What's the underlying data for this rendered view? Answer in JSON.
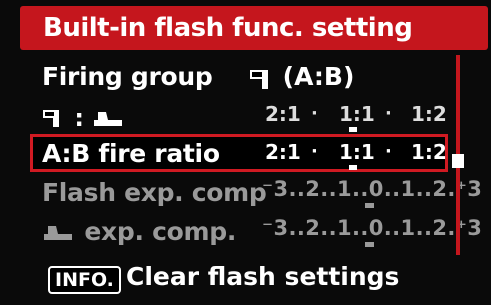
{
  "title": "Built-in flash func. setting",
  "rows": [
    {
      "label": "Firing group",
      "value": "(A:B)",
      "icon": "master-flash-icon"
    },
    {
      "label_icons": [
        "master-flash-icon",
        "slave-flash-icon"
      ],
      "ratio": [
        "2:1",
        "·",
        "1:1",
        "·",
        "1:2"
      ],
      "ratio_selected": "1:1"
    },
    {
      "label": "A:B fire ratio",
      "ratio": [
        "2:1",
        "·",
        "1:1",
        "·",
        "1:2"
      ],
      "ratio_selected": "1:1"
    },
    {
      "label": "Flash exp. comp",
      "scale": "⁻3..2..1..0..1..2.⁺3",
      "scale_value": 0
    },
    {
      "label": "exp. comp.",
      "label_icon": "slave-flash-icon",
      "scale": "⁻3..2..1..0..1..2.⁺3",
      "scale_value": 0
    }
  ],
  "footer": {
    "badge": "INFO.",
    "text": "Clear flash settings"
  },
  "colors": {
    "accent": "#c5161d",
    "background": "#000000",
    "dim_text": "#9a9a9a"
  }
}
